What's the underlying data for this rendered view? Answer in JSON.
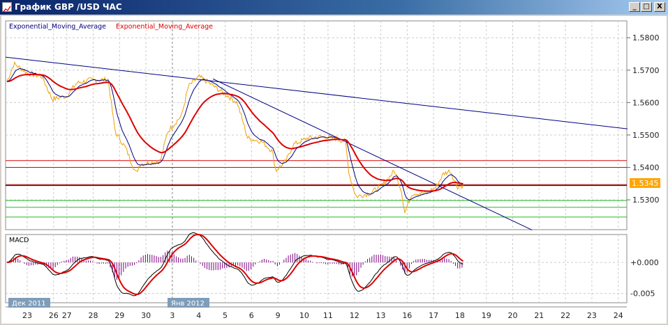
{
  "window": {
    "title": "График GBP /USD  ЧАС",
    "min_label": "_",
    "max_label": "□",
    "close_label": "X"
  },
  "legend": {
    "fast_ma": "Exponential_Moving_Average",
    "slow_ma": "Exponential_Moving_Average"
  },
  "macd_panel": {
    "label": "MACD",
    "ticks": [
      "+0.000",
      "-0.005"
    ]
  },
  "price_axis": {
    "ticks": [
      "1.5800",
      "1.5700",
      "1.5600",
      "1.5500",
      "1.5400",
      "1.5300"
    ],
    "current_price": "1.5345"
  },
  "month_labels": [
    "Дек 2011",
    "Янв 2012"
  ],
  "date_ticks": [
    "23",
    "26",
    "27",
    "28",
    "29",
    "30",
    "3",
    "4",
    "5",
    "6",
    "9",
    "10",
    "11",
    "12",
    "13",
    "16",
    "17",
    "18",
    "19",
    "20",
    "21",
    "22",
    "23",
    "24"
  ],
  "colors": {
    "price": "#f0a000",
    "fast_ma": "#000080",
    "slow_ma": "#dd0000",
    "macd_hist": "#800080",
    "current_price_bg": "#ffa500",
    "month_label_bg": "#7f9db9"
  },
  "chart_data": {
    "type": "line",
    "title": "GBP/USD hourly",
    "ylim": [
      1.5208,
      1.5852
    ],
    "date_tick_positions": [
      0,
      1,
      1.5,
      2.5,
      3.5,
      4.5,
      5.5,
      6.5,
      7.5,
      8.5,
      9.5,
      10.5,
      11.4,
      12.4,
      13.4,
      14.4,
      15.4,
      16.4,
      17.4,
      18.4,
      19.4,
      20.4,
      21.4,
      22.4
    ],
    "xlim": [
      -0.8,
      22.75
    ],
    "price_path": [
      [
        -0.77,
        1.5665
      ],
      [
        -0.5,
        1.572
      ],
      [
        0.03,
        1.569
      ],
      [
        0.56,
        1.568
      ],
      [
        0.95,
        1.561
      ],
      [
        1.48,
        1.562
      ],
      [
        1.88,
        1.566
      ],
      [
        2.41,
        1.567
      ],
      [
        3.07,
        1.567
      ],
      [
        3.33,
        1.551
      ],
      [
        3.73,
        1.546
      ],
      [
        4.13,
        1.538
      ],
      [
        4.26,
        1.541
      ],
      [
        5.05,
        1.542
      ],
      [
        5.32,
        1.551
      ],
      [
        5.85,
        1.556
      ],
      [
        6.11,
        1.565
      ],
      [
        6.51,
        1.568
      ],
      [
        6.9,
        1.566
      ],
      [
        7.43,
        1.563
      ],
      [
        7.96,
        1.56
      ],
      [
        8.36,
        1.549
      ],
      [
        8.89,
        1.548
      ],
      [
        9.29,
        1.545
      ],
      [
        9.42,
        1.539
      ],
      [
        9.81,
        1.542
      ],
      [
        10.08,
        1.547
      ],
      [
        10.61,
        1.549
      ],
      [
        11.14,
        1.5495
      ],
      [
        11.67,
        1.549
      ],
      [
        12.06,
        1.548
      ],
      [
        12.2,
        1.538
      ],
      [
        12.46,
        1.531
      ],
      [
        12.99,
        1.532
      ],
      [
        13.52,
        1.535
      ],
      [
        13.92,
        1.539
      ],
      [
        14.18,
        1.533
      ],
      [
        14.31,
        1.526
      ],
      [
        14.58,
        1.532
      ],
      [
        15.11,
        1.532
      ],
      [
        15.5,
        1.534
      ],
      [
        15.77,
        1.538
      ],
      [
        16.03,
        1.539
      ],
      [
        16.3,
        1.534
      ],
      [
        16.56,
        1.5345
      ]
    ],
    "trendlines": [
      {
        "from": [
          -0.82,
          1.574
        ],
        "to": [
          22.75,
          1.5519
        ],
        "color": "#000080"
      },
      {
        "from": [
          7.04,
          1.5673
        ],
        "to": [
          19.13,
          1.5207
        ],
        "color": "#000080"
      }
    ],
    "horizontal_levels": [
      {
        "value": 1.5421,
        "color": "#dd0000"
      },
      {
        "value": 1.54,
        "color": "#dd0000"
      },
      {
        "value": 1.5347,
        "color": "#990000"
      },
      {
        "value": 1.5344,
        "color": "#000000"
      },
      {
        "value": 1.5298,
        "color": "#22bb22"
      },
      {
        "value": 1.5277,
        "color": "#22bb22"
      },
      {
        "value": 1.5247,
        "color": "#22bb22"
      }
    ],
    "macd_ylim": [
      -0.0065,
      0.0045
    ],
    "series": [
      {
        "name": "Exponential_Moving_Average",
        "color": "#000080"
      },
      {
        "name": "Exponential_Moving_Average",
        "color": "#dd0000"
      }
    ]
  }
}
